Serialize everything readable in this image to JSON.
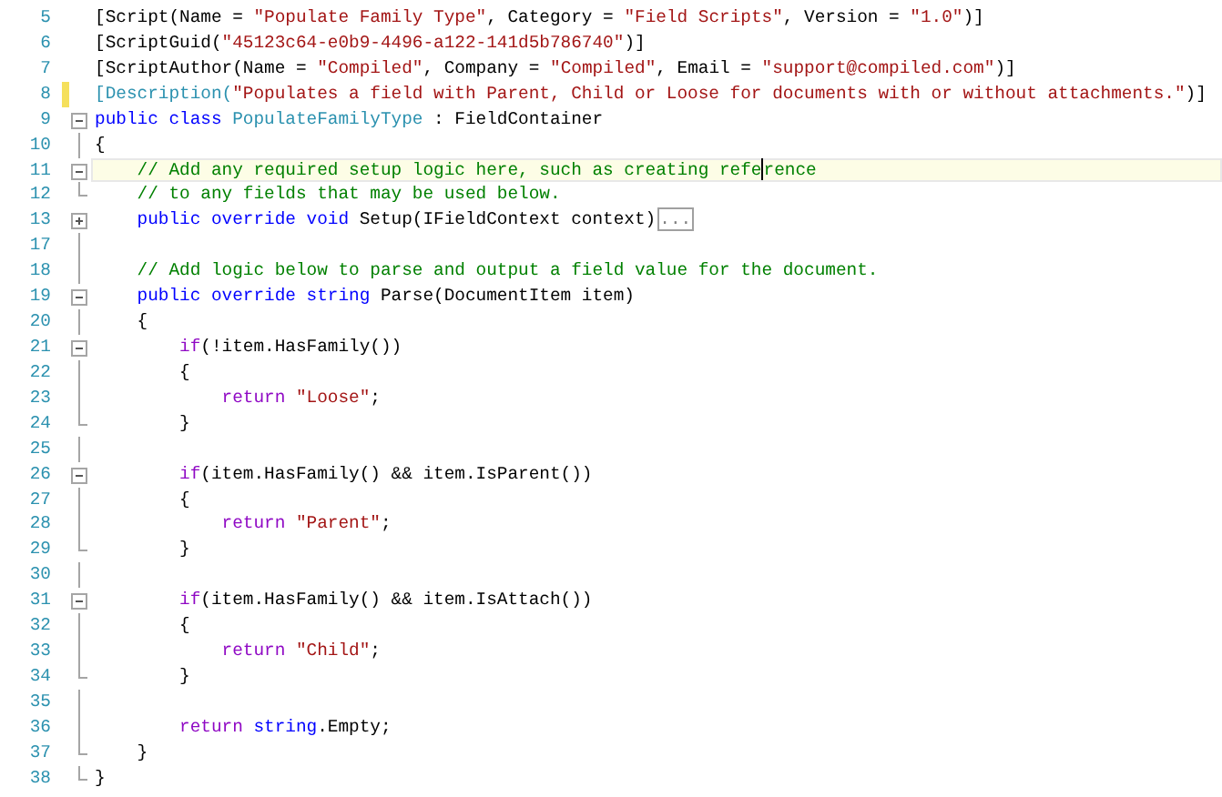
{
  "editor": {
    "lines": [
      {
        "number": "5",
        "modified": false,
        "current": false,
        "tokens": [
          {
            "kind": "plain",
            "text": "[Script(Name = "
          },
          {
            "kind": "string",
            "text": "\"Populate Family Type\""
          },
          {
            "kind": "plain",
            "text": ", Category = "
          },
          {
            "kind": "string",
            "text": "\"Field Scripts\""
          },
          {
            "kind": "plain",
            "text": ", Version = "
          },
          {
            "kind": "string",
            "text": "\"1.0\""
          },
          {
            "kind": "plain",
            "text": ")]"
          }
        ]
      },
      {
        "number": "6",
        "modified": false,
        "current": false,
        "tokens": [
          {
            "kind": "plain",
            "text": "[ScriptGuid("
          },
          {
            "kind": "string",
            "text": "\"45123c64-e0b9-4496-a122-141d5b786740\""
          },
          {
            "kind": "plain",
            "text": ")]"
          }
        ]
      },
      {
        "number": "7",
        "modified": false,
        "current": false,
        "tokens": [
          {
            "kind": "plain",
            "text": "[ScriptAuthor(Name = "
          },
          {
            "kind": "string",
            "text": "\"Compiled\""
          },
          {
            "kind": "plain",
            "text": ", Company = "
          },
          {
            "kind": "string",
            "text": "\"Compiled\""
          },
          {
            "kind": "plain",
            "text": ", Email = "
          },
          {
            "kind": "string",
            "text": "\"support@compiled.com\""
          },
          {
            "kind": "plain",
            "text": ")]"
          }
        ]
      },
      {
        "number": "8",
        "modified": true,
        "current": false,
        "tokens": [
          {
            "kind": "type",
            "text": "[Description("
          },
          {
            "kind": "string",
            "text": "\"Populates a field with Parent, Child or Loose for documents with or without attachments.\""
          },
          {
            "kind": "plain",
            "text": ")]"
          }
        ]
      },
      {
        "number": "9",
        "gutter": {
          "kind": "collapse"
        },
        "modified": false,
        "current": false,
        "tokens": [
          {
            "kind": "keyword",
            "text": "public class "
          },
          {
            "kind": "type",
            "text": "PopulateFamilyType"
          },
          {
            "kind": "plain",
            "text": " : FieldContainer"
          }
        ]
      },
      {
        "number": "10",
        "gutter": {
          "kind": "line"
        },
        "modified": false,
        "current": false,
        "tokens": [
          {
            "kind": "plain",
            "text": "{"
          }
        ]
      },
      {
        "number": "11",
        "gutter": {
          "kind": "collapse"
        },
        "modified": false,
        "current": true,
        "tokens": [
          {
            "kind": "comment",
            "text": "    // Add any required setup logic here, such as creating refe"
          },
          {
            "kind": "caret"
          },
          {
            "kind": "comment",
            "text": "rence"
          }
        ]
      },
      {
        "number": "12",
        "gutter": {
          "kind": "end"
        },
        "modified": false,
        "current": false,
        "tokens": [
          {
            "kind": "comment",
            "text": "    // to any fields that may be used below."
          }
        ]
      },
      {
        "number": "13",
        "gutter": {
          "kind": "expand"
        },
        "modified": false,
        "current": false,
        "tokens": [
          {
            "kind": "keyword",
            "text": "    public override void "
          },
          {
            "kind": "plain",
            "text": "Setup(IFieldContext context)"
          },
          {
            "kind": "collapsed",
            "text": "..."
          }
        ]
      },
      {
        "number": "17",
        "gutter": {
          "kind": "line"
        },
        "modified": false,
        "current": false
      },
      {
        "number": "18",
        "gutter": {
          "kind": "line"
        },
        "modified": false,
        "current": false,
        "tokens": [
          {
            "kind": "comment",
            "text": "    // Add logic below to parse and output a field value for the document."
          }
        ]
      },
      {
        "number": "19",
        "gutter": {
          "kind": "collapse"
        },
        "modified": false,
        "current": false,
        "tokens": [
          {
            "kind": "keyword",
            "text": "    public override string "
          },
          {
            "kind": "plain",
            "text": "Parse(DocumentItem item)"
          }
        ]
      },
      {
        "number": "20",
        "gutter": {
          "kind": "line"
        },
        "modified": false,
        "current": false,
        "tokens": [
          {
            "kind": "plain",
            "text": "    {"
          }
        ]
      },
      {
        "number": "21",
        "gutter": {
          "kind": "collapse"
        },
        "modified": false,
        "current": false,
        "tokens": [
          {
            "kind": "control",
            "text": "        if"
          },
          {
            "kind": "plain",
            "text": "(!item.HasFamily())"
          }
        ]
      },
      {
        "number": "22",
        "gutter": {
          "kind": "line"
        },
        "modified": false,
        "current": false,
        "tokens": [
          {
            "kind": "plain",
            "text": "        {"
          }
        ]
      },
      {
        "number": "23",
        "gutter": {
          "kind": "line"
        },
        "modified": false,
        "current": false,
        "tokens": [
          {
            "kind": "control",
            "text": "            return "
          },
          {
            "kind": "string",
            "text": "\"Loose\""
          },
          {
            "kind": "plain",
            "text": ";"
          }
        ]
      },
      {
        "number": "24",
        "gutter": {
          "kind": "end"
        },
        "modified": false,
        "current": false,
        "tokens": [
          {
            "kind": "plain",
            "text": "        }"
          }
        ]
      },
      {
        "number": "25",
        "gutter": {
          "kind": "line"
        },
        "modified": false,
        "current": false
      },
      {
        "number": "26",
        "gutter": {
          "kind": "collapse"
        },
        "modified": false,
        "current": false,
        "tokens": [
          {
            "kind": "control",
            "text": "        if"
          },
          {
            "kind": "plain",
            "text": "(item.HasFamily() && item.IsParent())"
          }
        ]
      },
      {
        "number": "27",
        "gutter": {
          "kind": "line"
        },
        "modified": false,
        "current": false,
        "tokens": [
          {
            "kind": "plain",
            "text": "        {"
          }
        ]
      },
      {
        "number": "28",
        "gutter": {
          "kind": "line"
        },
        "modified": false,
        "current": false,
        "tokens": [
          {
            "kind": "control",
            "text": "            return "
          },
          {
            "kind": "string",
            "text": "\"Parent\""
          },
          {
            "kind": "plain",
            "text": ";"
          }
        ]
      },
      {
        "number": "29",
        "gutter": {
          "kind": "end"
        },
        "modified": false,
        "current": false,
        "tokens": [
          {
            "kind": "plain",
            "text": "        }"
          }
        ]
      },
      {
        "number": "30",
        "gutter": {
          "kind": "line"
        },
        "modified": false,
        "current": false
      },
      {
        "number": "31",
        "gutter": {
          "kind": "collapse"
        },
        "modified": false,
        "current": false,
        "tokens": [
          {
            "kind": "control",
            "text": "        if"
          },
          {
            "kind": "plain",
            "text": "(item.HasFamily() && item.IsAttach())"
          }
        ]
      },
      {
        "number": "32",
        "gutter": {
          "kind": "line"
        },
        "modified": false,
        "current": false,
        "tokens": [
          {
            "kind": "plain",
            "text": "        {"
          }
        ]
      },
      {
        "number": "33",
        "gutter": {
          "kind": "line"
        },
        "modified": false,
        "current": false,
        "tokens": [
          {
            "kind": "control",
            "text": "            return "
          },
          {
            "kind": "string",
            "text": "\"Child\""
          },
          {
            "kind": "plain",
            "text": ";"
          }
        ]
      },
      {
        "number": "34",
        "gutter": {
          "kind": "end"
        },
        "modified": false,
        "current": false,
        "tokens": [
          {
            "kind": "plain",
            "text": "        }"
          }
        ]
      },
      {
        "number": "35",
        "gutter": {
          "kind": "line"
        },
        "modified": false,
        "current": false
      },
      {
        "number": "36",
        "gutter": {
          "kind": "line"
        },
        "modified": false,
        "current": false,
        "tokens": [
          {
            "kind": "control",
            "text": "        return "
          },
          {
            "kind": "keyword",
            "text": "string"
          },
          {
            "kind": "plain",
            "text": ".Empty;"
          }
        ]
      },
      {
        "number": "37",
        "gutter": {
          "kind": "end"
        },
        "modified": false,
        "current": false,
        "tokens": [
          {
            "kind": "plain",
            "text": "    }"
          }
        ]
      },
      {
        "number": "38",
        "gutter": {
          "kind": "end"
        },
        "modified": false,
        "current": false,
        "tokens": [
          {
            "kind": "plain",
            "text": "}"
          }
        ]
      }
    ]
  }
}
